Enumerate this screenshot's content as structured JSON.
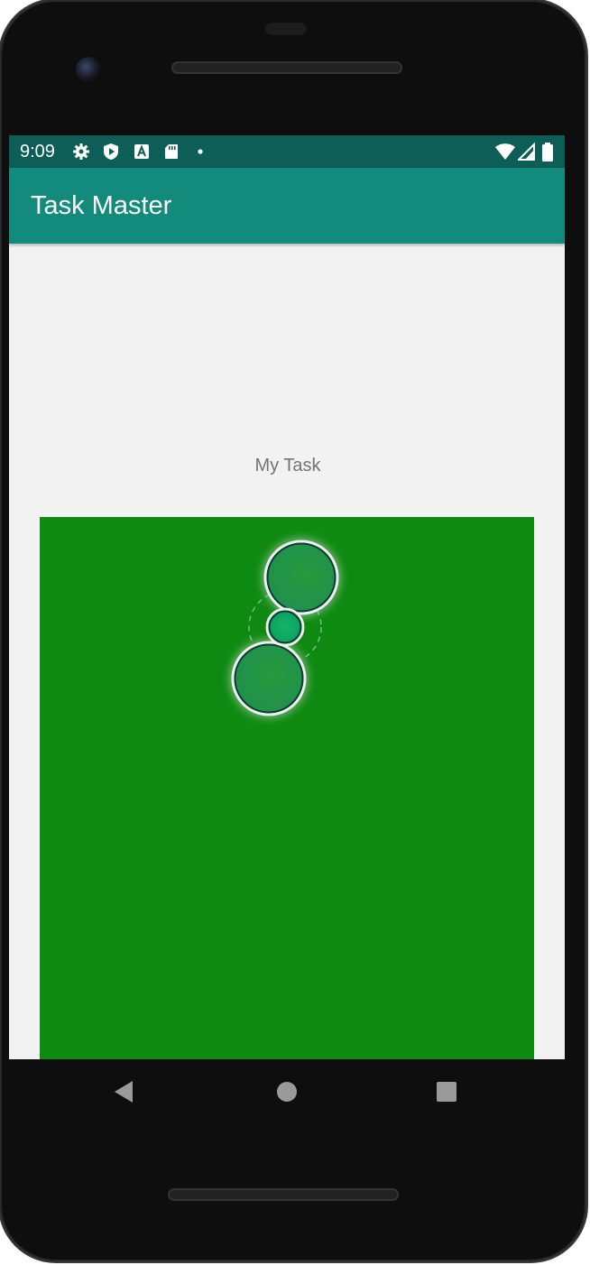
{
  "status_bar": {
    "time": "9:09",
    "left_icons": [
      "gear-icon",
      "shield-play-icon",
      "a-icon",
      "sd-card-icon",
      "dot-icon"
    ],
    "right_icons": [
      "wifi-icon",
      "signal-icon",
      "battery-icon"
    ]
  },
  "app_bar": {
    "title": "Task Master"
  },
  "main": {
    "task_label": "My Task",
    "canvas_color": "#0f8a11",
    "nodes": [
      "large-circle-top",
      "small-circle-middle",
      "large-circle-bottom"
    ]
  },
  "nav_bar": {
    "buttons": [
      "back-icon",
      "home-icon",
      "recent-apps-icon"
    ]
  },
  "colors": {
    "status_bar": "#0d5e56",
    "app_bar": "#128a7c",
    "background": "#f2f2f2",
    "green_canvas": "#0f8a11",
    "node_fill": "#1d9b4b"
  }
}
